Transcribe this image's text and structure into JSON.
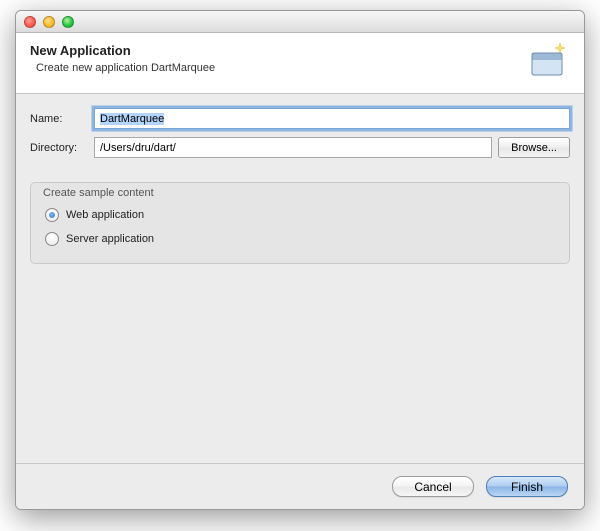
{
  "header": {
    "title": "New Application",
    "subtitle": "Create new application DartMarquee"
  },
  "form": {
    "name_label": "Name:",
    "name_value": "DartMarquee",
    "directory_label": "Directory:",
    "directory_value": "/Users/dru/dart/",
    "browse_label": "Browse..."
  },
  "sample": {
    "group_title": "Create sample content",
    "options": [
      {
        "label": "Web application",
        "checked": true
      },
      {
        "label": "Server application",
        "checked": false
      }
    ]
  },
  "footer": {
    "cancel_label": "Cancel",
    "finish_label": "Finish"
  }
}
